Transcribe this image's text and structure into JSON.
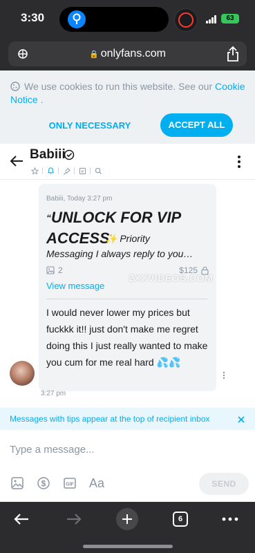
{
  "status_bar": {
    "time": "3:30",
    "battery": "63"
  },
  "browser": {
    "url": "onlyfans.com",
    "tab_count": "6"
  },
  "cookie_banner": {
    "text": "We use cookies to run this website. See our ",
    "link_text": "Cookie Notice",
    "text_end": " .",
    "necessary_label": "ONLY NECESSARY COOKIES",
    "accept_label": "ACCEPT ALL"
  },
  "chat_header": {
    "name": "Babiii"
  },
  "message": {
    "meta": "Babiii, Today 3:27 pm",
    "title_quote": "“",
    "title": "UNLOCK FOR VIP ACCESS",
    "sparkle": "✨",
    "subtitle_first": "Priority",
    "subtitle": "Messaging I always reply to you…",
    "media_count": "2",
    "price": "$125",
    "view_message": "View message",
    "body": "I would never lower my prices but fuckkk it!! just don't make me regret doing this I just really wanted to make you cum for me real hard 💦💦",
    "time": "3:27 pm",
    "watermark": "2XXVIDEOS.COM"
  },
  "tips_notice": {
    "text": "Messages with tips appear at the top of recipient inbox"
  },
  "composer": {
    "placeholder": "Type a message...",
    "send_label": "SEND",
    "text_tool": "Aa"
  },
  "colors": {
    "accent": "#00aff0",
    "banner_bg": "#eef1f4",
    "bubble_bg": "#f2f3f5",
    "browser_chrome": "#2c2c2e"
  }
}
